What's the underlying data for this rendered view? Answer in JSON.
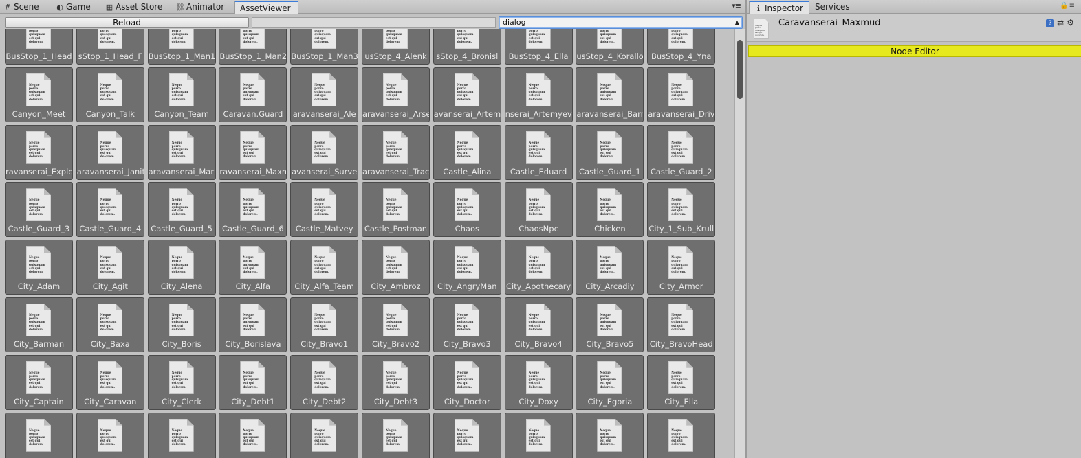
{
  "left_tabs": [
    {
      "label": "Scene",
      "icon": "grid-icon",
      "glyph": "#"
    },
    {
      "label": "Game",
      "icon": "game-icon",
      "glyph": "◐"
    },
    {
      "label": "Asset Store",
      "icon": "store-icon",
      "glyph": "▦"
    },
    {
      "label": "Animator",
      "icon": "animator-icon",
      "glyph": "⛓"
    },
    {
      "label": "AssetViewer",
      "icon": "",
      "glyph": ""
    }
  ],
  "toolbar": {
    "reload_label": "Reload",
    "text_value": "",
    "filter_value": "dialog"
  },
  "doc_preview_text": "Neque porro quisquam est qui dolorem.",
  "assets": [
    "BusStop_1_Head",
    "sStop_1_Head_F",
    "BusStop_1_Man1",
    "BusStop_1_Man2",
    "BusStop_1_Man3",
    "usStop_4_Alenk",
    "sStop_4_Bronisl",
    "BusStop_4_Ella",
    "usStop_4_Korallo",
    "BusStop_4_Yna",
    "Canyon_Meet",
    "Canyon_Talk",
    "Canyon_Team",
    "Caravan.Guard",
    "aravanserai_Ale",
    "aravanserai_Arse",
    "avanserai_Artem",
    "nserai_Artemyev",
    "aravanserai_Barm",
    "aravanserai_Driv",
    "ravanserai_Explo",
    "aravanserai_Janit",
    "aravanserai_Mari",
    "ravanserai_Maxm",
    "avanserai_Surve",
    "aravanserai_Trac",
    "Castle_Alina",
    "Castle_Eduard",
    "Castle_Guard_1",
    "Castle_Guard_2",
    "Castle_Guard_3",
    "Castle_Guard_4",
    "Castle_Guard_5",
    "Castle_Guard_6",
    "Castle_Matvey",
    "Castle_Postman",
    "Chaos",
    "ChaosNpc",
    "Chicken",
    "City_1_Sub_Krull",
    "City_Adam",
    "City_Agit",
    "City_Alena",
    "City_Alfa",
    "City_Alfa_Team",
    "City_Ambroz",
    "City_AngryMan",
    "City_Apothecary",
    "City_Arcadiy",
    "City_Armor",
    "City_Barman",
    "City_Baxa",
    "City_Boris",
    "City_Borislava",
    "City_Bravo1",
    "City_Bravo2",
    "City_Bravo3",
    "City_Bravo4",
    "City_Bravo5",
    "City_BravoHead",
    "City_Captain",
    "City_Caravan",
    "City_Clerk",
    "City_Debt1",
    "City_Debt2",
    "City_Debt3",
    "City_Doctor",
    "City_Doxy",
    "City_Egoria",
    "City_Ella",
    "",
    "",
    "",
    "",
    "",
    "",
    "",
    "",
    "",
    ""
  ],
  "right_tabs": [
    {
      "label": "Inspector",
      "icon": "info-icon",
      "glyph": "ℹ"
    },
    {
      "label": "Services",
      "icon": "",
      "glyph": ""
    }
  ],
  "inspector": {
    "asset_name": "Caravanserai_Maxmud",
    "node_editor_label": "Node Editor"
  },
  "colors": {
    "active_tab_accent": "#3b7bd9",
    "node_editor_bg": "#e7e91f",
    "cell_bg": "#6f6f6f",
    "panel_bg": "#c2c2c2"
  }
}
